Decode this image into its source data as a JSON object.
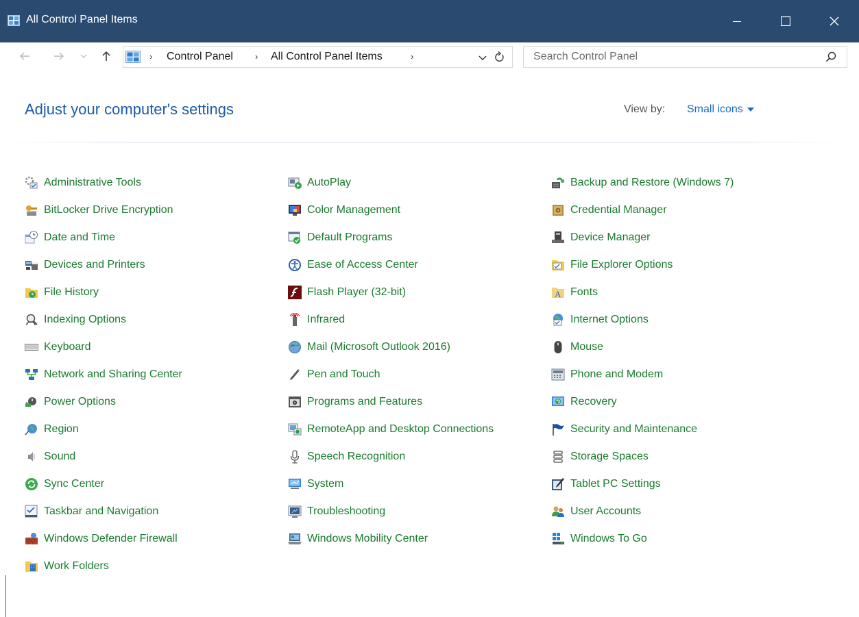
{
  "window": {
    "title": "All Control Panel Items"
  },
  "breadcrumb": [
    "Control Panel",
    "All Control Panel Items"
  ],
  "search": {
    "placeholder": "Search Control Panel"
  },
  "header": {
    "title": "Adjust your computer's settings",
    "view_by_label": "View by:",
    "view_by_value": "Small icons"
  },
  "colors": {
    "titlebar": "#2b4a70",
    "heading": "#1e5aa8",
    "link": "#1a7a2e",
    "accent": "#1e6ac7"
  },
  "columns": [
    [
      {
        "label": "Administrative Tools",
        "icon": "admin-tools-icon"
      },
      {
        "label": "BitLocker Drive Encryption",
        "icon": "bitlocker-icon"
      },
      {
        "label": "Date and Time",
        "icon": "date-time-icon"
      },
      {
        "label": "Devices and Printers",
        "icon": "devices-printers-icon"
      },
      {
        "label": "File History",
        "icon": "file-history-icon"
      },
      {
        "label": "Indexing Options",
        "icon": "indexing-icon"
      },
      {
        "label": "Keyboard",
        "icon": "keyboard-icon"
      },
      {
        "label": "Network and Sharing Center",
        "icon": "network-icon"
      },
      {
        "label": "Power Options",
        "icon": "power-icon"
      },
      {
        "label": "Region",
        "icon": "region-icon"
      },
      {
        "label": "Sound",
        "icon": "sound-icon"
      },
      {
        "label": "Sync Center",
        "icon": "sync-icon"
      },
      {
        "label": "Taskbar and Navigation",
        "icon": "taskbar-icon"
      },
      {
        "label": "Windows Defender Firewall",
        "icon": "firewall-icon"
      },
      {
        "label": "Work Folders",
        "icon": "work-folders-icon"
      }
    ],
    [
      {
        "label": "AutoPlay",
        "icon": "autoplay-icon"
      },
      {
        "label": "Color Management",
        "icon": "color-management-icon"
      },
      {
        "label": "Default Programs",
        "icon": "default-programs-icon"
      },
      {
        "label": "Ease of Access Center",
        "icon": "ease-of-access-icon"
      },
      {
        "label": "Flash Player (32-bit)",
        "icon": "flash-player-icon"
      },
      {
        "label": "Infrared",
        "icon": "infrared-icon"
      },
      {
        "label": "Mail (Microsoft Outlook 2016)",
        "icon": "mail-icon"
      },
      {
        "label": "Pen and Touch",
        "icon": "pen-icon"
      },
      {
        "label": "Programs and Features",
        "icon": "programs-icon"
      },
      {
        "label": "RemoteApp and Desktop Connections",
        "icon": "remoteapp-icon"
      },
      {
        "label": "Speech Recognition",
        "icon": "microphone-icon"
      },
      {
        "label": "System",
        "icon": "system-icon"
      },
      {
        "label": "Troubleshooting",
        "icon": "troubleshooting-icon"
      },
      {
        "label": "Windows Mobility Center",
        "icon": "mobility-icon"
      }
    ],
    [
      {
        "label": "Backup and Restore (Windows 7)",
        "icon": "backup-icon"
      },
      {
        "label": "Credential Manager",
        "icon": "credential-icon"
      },
      {
        "label": "Device Manager",
        "icon": "device-manager-icon"
      },
      {
        "label": "File Explorer Options",
        "icon": "folder-options-icon"
      },
      {
        "label": "Fonts",
        "icon": "fonts-icon"
      },
      {
        "label": "Internet Options",
        "icon": "internet-options-icon"
      },
      {
        "label": "Mouse",
        "icon": "mouse-icon"
      },
      {
        "label": "Phone and Modem",
        "icon": "phone-modem-icon"
      },
      {
        "label": "Recovery",
        "icon": "recovery-icon"
      },
      {
        "label": "Security and Maintenance",
        "icon": "flag-icon"
      },
      {
        "label": "Storage Spaces",
        "icon": "storage-icon"
      },
      {
        "label": "Tablet PC Settings",
        "icon": "tablet-icon"
      },
      {
        "label": "User Accounts",
        "icon": "users-icon"
      },
      {
        "label": "Windows To Go",
        "icon": "windows-to-go-icon"
      }
    ]
  ]
}
